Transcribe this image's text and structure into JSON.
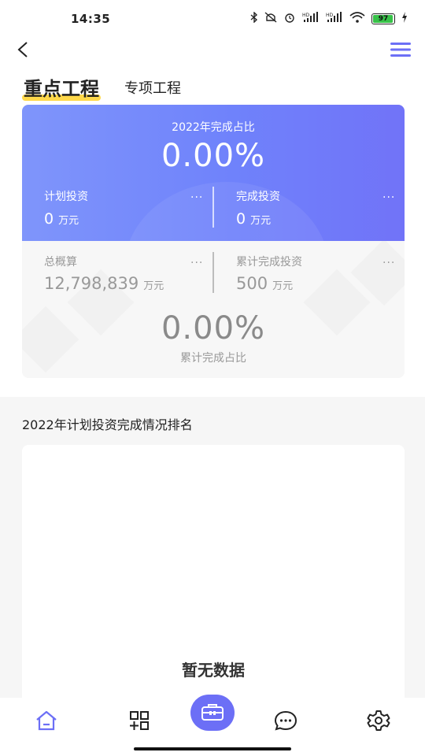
{
  "status_bar": {
    "time": "14:35",
    "battery": "97",
    "icons": [
      "bluetooth-icon",
      "mute-icon",
      "alarm-icon",
      "hd-signal-icon",
      "hd-signal-icon",
      "wifi-icon",
      "battery-icon",
      "charging-icon"
    ]
  },
  "header": {
    "back_icon": "chevron-left-icon",
    "menu_icon": "hamburger-menu-icon",
    "tabs": [
      {
        "label": "重点工程",
        "active": true
      },
      {
        "label": "专项工程",
        "active": false
      }
    ]
  },
  "summary": {
    "year_ratio_label": "2022年完成占比",
    "year_ratio_value": "0.00%",
    "planned": {
      "label": "计划投资",
      "value": "0",
      "unit": "万元",
      "more": "..."
    },
    "completed": {
      "label": "完成投资",
      "value": "0",
      "unit": "万元",
      "more": "..."
    },
    "budget": {
      "label": "总概算",
      "value": "12,798,839",
      "unit": "万元",
      "more": "..."
    },
    "cumulative": {
      "label": "累计完成投资",
      "value": "500",
      "unit": "万元",
      "more": "..."
    },
    "total_ratio_value": "0.00%",
    "total_ratio_label": "累计完成占比"
  },
  "ranking": {
    "title": "2022年计划投资完成情况排名",
    "empty_text": "暂无数据"
  },
  "bottom_nav": {
    "items": [
      "home-icon",
      "grid-icon",
      "toolbox-icon",
      "chat-icon",
      "settings-icon"
    ],
    "accent_color": "#6c6ff6"
  },
  "colors": {
    "card_gradient_start": "#7f95fb",
    "card_gradient_end": "#7173f8",
    "tab_underline": "#ffd84a"
  }
}
